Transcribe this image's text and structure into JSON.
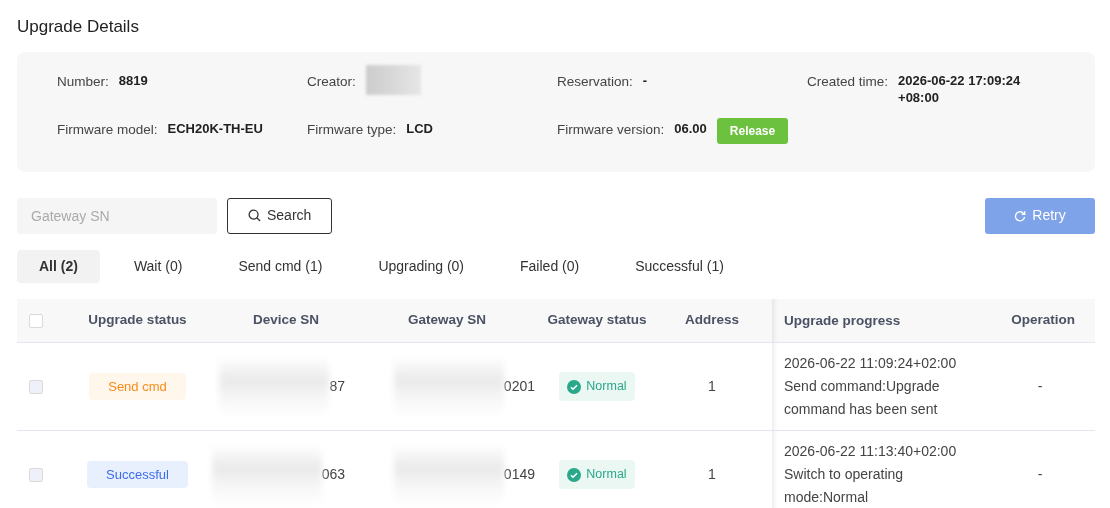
{
  "title": "Upgrade Details",
  "details": [
    {
      "label": "Number:",
      "value": "8819"
    },
    {
      "label": "Creator:",
      "redacted": true
    },
    {
      "label": "Reservation:",
      "value": "-"
    },
    {
      "label": "Created time:",
      "value": "2026-06-22 17:09:24 +08:00"
    },
    {
      "label": "Firmware model:",
      "value": "ECH20K-TH-EU"
    },
    {
      "label": "Firmware type:",
      "value": "LCD"
    },
    {
      "label": "Firmware version:",
      "value": "06.00",
      "tag": "Release"
    }
  ],
  "search": {
    "placeholder": "Gateway SN",
    "button": "Search"
  },
  "retry": {
    "label": "Retry",
    "disabled": true
  },
  "tabs": [
    {
      "label": "All (2)",
      "selected": true
    },
    {
      "label": "Wait (0)",
      "selected": false
    },
    {
      "label": "Send cmd (1)",
      "selected": false
    },
    {
      "label": "Upgrading (0)",
      "selected": false
    },
    {
      "label": "Failed (0)",
      "selected": false
    },
    {
      "label": "Successful (1)",
      "selected": false
    }
  ],
  "table": {
    "select_all": {
      "checked": false,
      "disabled": false
    },
    "columns": [
      "Upgrade status",
      "Device SN",
      "Gateway SN",
      "Gateway status",
      "Address",
      "Upgrade progress",
      "Operation"
    ],
    "rows": [
      {
        "checked": false,
        "disabled": true,
        "status": {
          "label": "Send cmd",
          "kind": "send"
        },
        "device_sn": "87",
        "gateway_sn": "0201",
        "gateway_status": {
          "label": "Normal",
          "kind": "normal"
        },
        "address": "1",
        "progress_time": "2026-06-22 11:09:24+02:00",
        "progress_text": "Send command:Upgrade command has been sent",
        "operation": "-"
      },
      {
        "checked": false,
        "disabled": true,
        "status": {
          "label": "Successful",
          "kind": "success"
        },
        "device_sn": "063",
        "gateway_sn": "0149",
        "gateway_status": {
          "label": "Normal",
          "kind": "normal"
        },
        "address": "1",
        "progress_time": "2026-06-22 11:13:40+02:00",
        "progress_text": "Switch to operating mode:Normal",
        "operation": "-"
      }
    ]
  }
}
